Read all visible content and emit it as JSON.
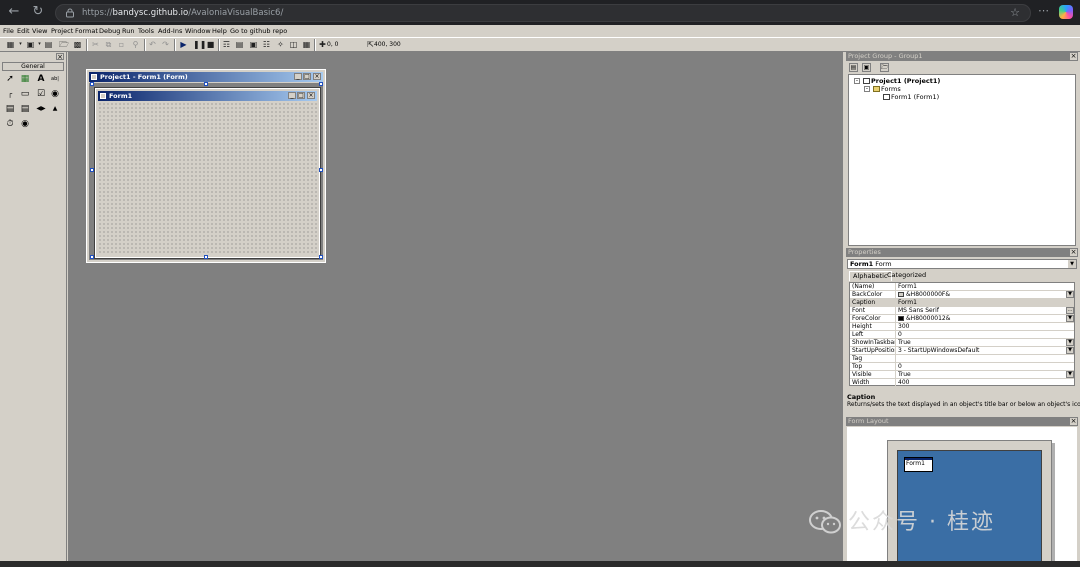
{
  "browser": {
    "url_prefix": "https://",
    "url_host": "bandysc.github.io",
    "url_path": "/AvaloniaVisualBasic6/"
  },
  "menu": [
    "File",
    "Edit",
    "View",
    "Project",
    "Format",
    "Debug",
    "Run",
    "Tools",
    "Add-Ins",
    "Window",
    "Help",
    "Go to github repo"
  ],
  "toolbar": {
    "position": "0, 0",
    "size": "400, 300"
  },
  "toolbox": {
    "tab": "General"
  },
  "designer": {
    "project_window_title": "Project1 - Form1 (Form)",
    "form_title": "Form1"
  },
  "project_group": {
    "title": "Project Group - Group1",
    "project": "Project1 (Project1)",
    "folder": "Forms",
    "form": "Form1 (Form1)"
  },
  "properties": {
    "title": "Properties",
    "object_name": "Form1",
    "object_type": "Form",
    "tab_alpha": "Alphabetic",
    "tab_cat": "Categorized",
    "rows": [
      {
        "name": "(Name)",
        "value": "Form1"
      },
      {
        "name": "BackColor",
        "value": "&H8000000F&"
      },
      {
        "name": "Caption",
        "value": "Form1"
      },
      {
        "name": "Font",
        "value": "MS Sans Serif"
      },
      {
        "name": "ForeColor",
        "value": "&H80000012&"
      },
      {
        "name": "Height",
        "value": "300"
      },
      {
        "name": "Left",
        "value": "0"
      },
      {
        "name": "ShowInTaskbar",
        "value": "True"
      },
      {
        "name": "StartUpPosition",
        "value": "3 - StartUpWindowsDefault"
      },
      {
        "name": "Tag",
        "value": ""
      },
      {
        "name": "Top",
        "value": "0"
      },
      {
        "name": "Visible",
        "value": "True"
      },
      {
        "name": "Width",
        "value": "400"
      }
    ],
    "description_title": "Caption",
    "description_text": "Returns/sets the text displayed in an object's title bar or below an object's icon."
  },
  "form_layout": {
    "title": "Form Layout",
    "form_label": "Form1"
  },
  "watermark": "公众号 · 桂迹",
  "colors": {
    "backcolor_swatch": "#d4d0c8",
    "forecolor_swatch": "#000000",
    "desktop": "#3a6ea5",
    "title_active": "#0a246a"
  }
}
